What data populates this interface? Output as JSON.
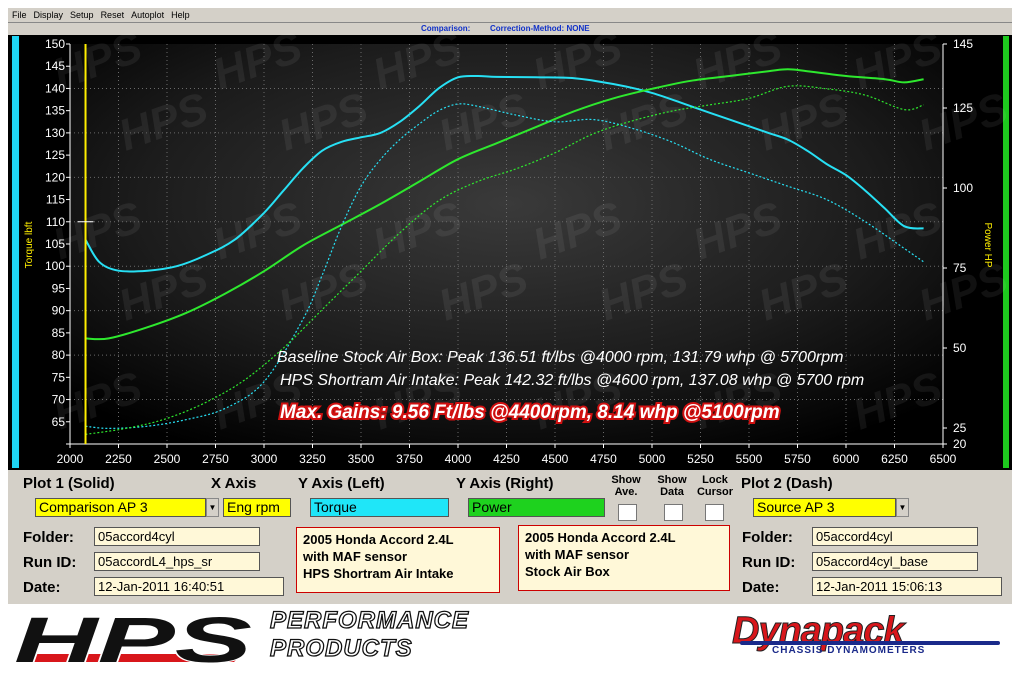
{
  "menu": [
    "File",
    "Display",
    "Setup",
    "Reset",
    "Autoplot",
    "Help"
  ],
  "status": {
    "comparison": "Comparison:",
    "correction": "Correction-Method: NONE"
  },
  "axis_left_label": "Torque lbft",
  "axis_right_label": "Power HP",
  "annotations": {
    "baseline": "Baseline Stock Air Box: Peak 136.51 ft/lbs @4000 rpm, 131.79 whp @ 5700rpm",
    "hps": "HPS Shortram Air Intake: Peak 142.32 ft/lbs @4600 rpm, 137.08 whp @ 5700 rpm",
    "gains": "Max. Gains:  9.56 Ft/lbs @4400rpm, 8.14 whp @5100rpm"
  },
  "chart_data": {
    "type": "line",
    "x_label": "",
    "xlim": [
      2000,
      6500
    ],
    "x_ticks": [
      2000,
      2250,
      2500,
      2750,
      3000,
      3250,
      3500,
      3750,
      4000,
      4250,
      4500,
      4750,
      5000,
      5250,
      5500,
      5750,
      6000,
      6250,
      6500
    ],
    "y_left_lim": [
      60,
      150
    ],
    "y_left_ticks": [
      60,
      65,
      70,
      75,
      80,
      85,
      90,
      95,
      100,
      105,
      110,
      115,
      120,
      125,
      130,
      135,
      140,
      145,
      150
    ],
    "y_right_lim": [
      20,
      145
    ],
    "y_right_ticks": [
      20,
      25,
      50,
      75,
      100,
      125,
      145
    ],
    "cursor_x": 2080,
    "series": [
      {
        "id": "torque_hps",
        "axis": "left",
        "style": "solid",
        "color": "#27e0f4",
        "x": [
          2080,
          2150,
          2250,
          2400,
          2550,
          2700,
          2850,
          3000,
          3100,
          3200,
          3300,
          3400,
          3500,
          3600,
          3700,
          3800,
          3900,
          4000,
          4100,
          4200,
          4400,
          4600,
          4800,
          5000,
          5200,
          5400,
          5600,
          5700,
          5800,
          5900,
          6000,
          6100,
          6200,
          6300,
          6400
        ],
        "y": [
          106,
          101,
          99,
          99,
          100,
          102.5,
          106,
          112,
          117,
          122,
          126,
          128,
          129,
          130,
          132.5,
          136,
          140,
          142.5,
          142.8,
          142.6,
          142.5,
          142.3,
          141,
          139,
          136,
          133,
          130,
          128.5,
          126,
          123,
          120.5,
          117,
          113,
          109,
          108.5
        ]
      },
      {
        "id": "power_hps",
        "axis": "right",
        "style": "solid",
        "color": "#2ee82e",
        "x": [
          2080,
          2200,
          2400,
          2600,
          2800,
          3000,
          3200,
          3400,
          3600,
          3800,
          4000,
          4200,
          4400,
          4600,
          4800,
          5000,
          5200,
          5400,
          5600,
          5700,
          5800,
          6000,
          6200,
          6300,
          6400
        ],
        "y": [
          53,
          53,
          56.5,
          61,
          67,
          74,
          82,
          88.5,
          95,
          102,
          109,
          114,
          119,
          124,
          128,
          131,
          133.5,
          135,
          136.5,
          137.08,
          136.5,
          135,
          134,
          133,
          134
        ]
      },
      {
        "id": "torque_base",
        "axis": "left",
        "style": "dash",
        "color": "#27e0f4",
        "x": [
          2080,
          2200,
          2400,
          2600,
          2800,
          3000,
          3200,
          3300,
          3400,
          3500,
          3600,
          3700,
          3800,
          3900,
          4000,
          4100,
          4300,
          4500,
          4700,
          4900,
          5100,
          5300,
          5500,
          5700,
          5900,
          6100,
          6300,
          6400
        ],
        "y": [
          64,
          63.5,
          64,
          65.5,
          68,
          74,
          88,
          98,
          109,
          118,
          124,
          128.5,
          132,
          135,
          136.5,
          136,
          134,
          132.5,
          133,
          131,
          128,
          124,
          121,
          118,
          115,
          110,
          104,
          101
        ]
      },
      {
        "id": "power_base",
        "axis": "right",
        "style": "dash",
        "color": "#2ee82e",
        "x": [
          2080,
          2300,
          2500,
          2700,
          2900,
          3100,
          3300,
          3500,
          3700,
          3900,
          4100,
          4300,
          4500,
          4700,
          4900,
          5100,
          5300,
          5500,
          5700,
          5900,
          6100,
          6300,
          6400
        ],
        "y": [
          23,
          25,
          28,
          33,
          40,
          50,
          62,
          74,
          86,
          96,
          102,
          106,
          111,
          117,
          121,
          124,
          126,
          128,
          131.79,
          131,
          129,
          124.5,
          126
        ]
      }
    ]
  },
  "controls": {
    "plot1_label": "Plot 1 (Solid)",
    "plot1_value": "Comparison AP 3",
    "xaxis_label": "X Axis",
    "xaxis_value": "Eng rpm",
    "yleft_label": "Y Axis (Left)",
    "yleft_value": "Torque",
    "yright_label": "Y Axis (Right)",
    "yright_value": "Power",
    "show_ave": "Show\nAve.",
    "show_data": "Show\nData",
    "lock_cursor": "Lock\nCursor",
    "plot2_label": "Plot 2 (Dash)",
    "plot2_value": "Source AP 3",
    "folder_label": "Folder:",
    "runid_label": "Run ID:",
    "date_label": "Date:",
    "plot1_folder": "05accord4cyl",
    "plot1_runid": "05accordL4_hps_sr",
    "plot1_date": "12-Jan-2011   16:40:51",
    "plot1_note": "2005 Honda Accord 2.4L\nwith MAF sensor\nHPS Shortram Air Intake",
    "plot2_note": "2005 Honda Accord 2.4L\nwith MAF sensor\nStock Air Box",
    "plot2_folder": "05accord4cyl",
    "plot2_runid": "05accord4cyl_base",
    "plot2_date": "12-Jan-2011   15:06:13"
  },
  "footer": {
    "hps_logo": "HPS",
    "performance": "PERFORMANCE",
    "products": "PRODUCTS",
    "dynapack": "Dynapack",
    "dynapack_sub": "CHASSIS DYNAMOMETERS"
  }
}
